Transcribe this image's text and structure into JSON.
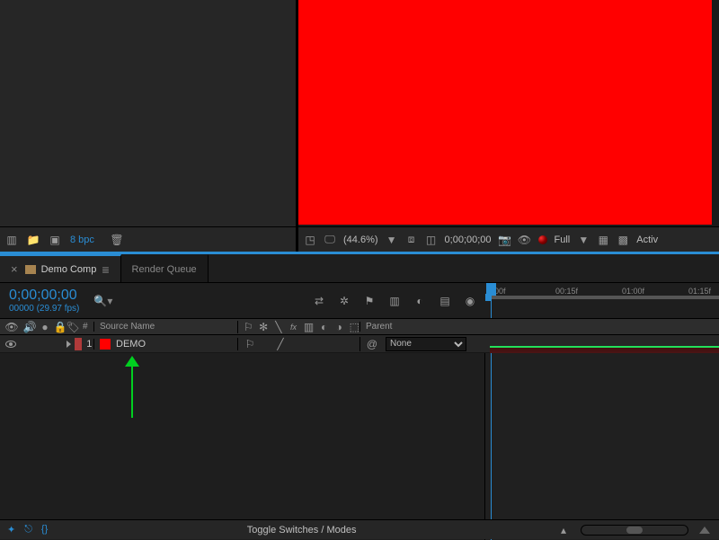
{
  "project_toolbar": {
    "bpc_label": "8 bpc"
  },
  "preview_toolbar": {
    "zoom_pct": "(44.6%)",
    "timecode": "0;00;00;00",
    "resolution": "Full",
    "active_cam": "Activ"
  },
  "tabs": {
    "active": {
      "label": "Demo Comp"
    },
    "render_queue": {
      "label": "Render Queue"
    }
  },
  "timeline_header": {
    "timecode": "0;00;00;00",
    "frame_info": "00000 (29.97 fps)"
  },
  "columns": {
    "index": "#",
    "source_name": "Source Name",
    "parent": "Parent"
  },
  "layers": [
    {
      "index": "1",
      "name": "DEMO",
      "parent": "None",
      "color": "#ff0000"
    }
  ],
  "ruler": {
    "marks": [
      "00f",
      "00:15f",
      "01:00f",
      "01:15f"
    ]
  },
  "footer": {
    "toggle_label": "Toggle Switches / Modes"
  }
}
